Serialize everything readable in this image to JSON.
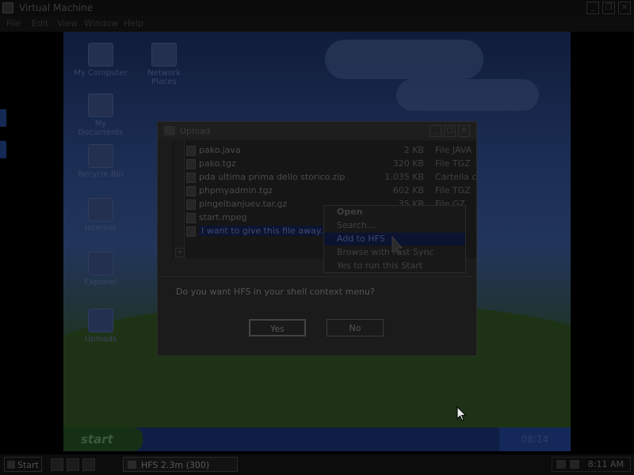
{
  "host_window": {
    "title": "Virtual Machine",
    "controls": [
      "_",
      "❐",
      "✕"
    ],
    "menu": [
      "File",
      "Edit",
      "View",
      "Window",
      "Help"
    ]
  },
  "desktop_icons": [
    {
      "label": "My Computer",
      "icon": "computer-icon"
    },
    {
      "label": "Network Places",
      "icon": "network-icon"
    },
    {
      "label": "My Documents",
      "icon": "folder-icon"
    },
    {
      "label": "Recycle Bin",
      "icon": "recycle-bin-icon"
    },
    {
      "label": "Internet",
      "icon": "browser-icon"
    },
    {
      "label": "Explorer",
      "icon": "explorer-icon"
    },
    {
      "label": "Uploads",
      "icon": "upload-icon"
    }
  ],
  "guest_taskbar": {
    "start": "start",
    "clock": "08:14"
  },
  "dialog": {
    "title": "Upload",
    "controls": [
      "_",
      "□",
      "✕"
    ],
    "files": [
      {
        "name": "pako.java",
        "size": "2 KB",
        "type": "File JAVA"
      },
      {
        "name": "pako.tgz",
        "size": "320 KB",
        "type": "File TGZ"
      },
      {
        "name": "pda ultima prima dello storico.zip",
        "size": "1.035 KB",
        "type": "Cartella compr"
      },
      {
        "name": "phpmyadmin.tgz",
        "size": "602 KB",
        "type": "File TGZ"
      },
      {
        "name": "pingelbanjuev.tar.gz",
        "size": "35 KB",
        "type": "File GZ"
      },
      {
        "name": "start.mpeg",
        "size": "",
        "type": ""
      },
      {
        "name": "I want to give this file away.zip",
        "size": "",
        "type": ""
      }
    ],
    "context_menu": [
      "Open",
      "Search...",
      "Add to HFS",
      "Browse with Fast Sync",
      "Yes to run this Start"
    ],
    "question": "Do you want HFS in your shell context menu?",
    "buttons": {
      "yes": "Yes",
      "no": "No"
    }
  },
  "host_taskbar": {
    "start": "Start",
    "task": "HFS 2.3m (300)",
    "clock": "8:11 AM"
  }
}
